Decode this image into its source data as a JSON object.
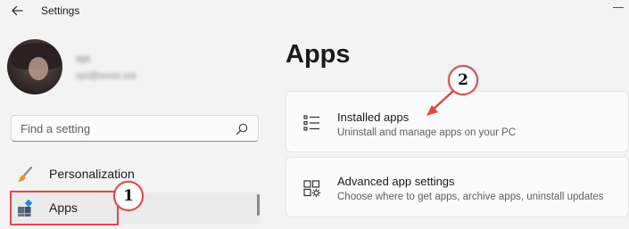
{
  "window": {
    "title": "Settings",
    "accent": "#0067c0"
  },
  "user": {
    "name": "xyz",
    "email": "xyz@xxxxx.xxx"
  },
  "search": {
    "placeholder": "Find a setting",
    "icon": "search-icon"
  },
  "sidebar": {
    "items": [
      {
        "label": "Personalization",
        "icon": "paintbrush-icon",
        "selected": false
      },
      {
        "label": "Apps",
        "icon": "apps-icon",
        "selected": true
      }
    ]
  },
  "main": {
    "title": "Apps",
    "cards": [
      {
        "title": "Installed apps",
        "subtitle": "Uninstall and manage apps on your PC",
        "icon": "list-icon"
      },
      {
        "title": "Advanced app settings",
        "subtitle": "Choose where to get apps, archive apps, uninstall updates",
        "icon": "app-settings-icon"
      }
    ]
  },
  "annotations": {
    "step1": "1",
    "step2": "2",
    "color": "#e0474c"
  }
}
